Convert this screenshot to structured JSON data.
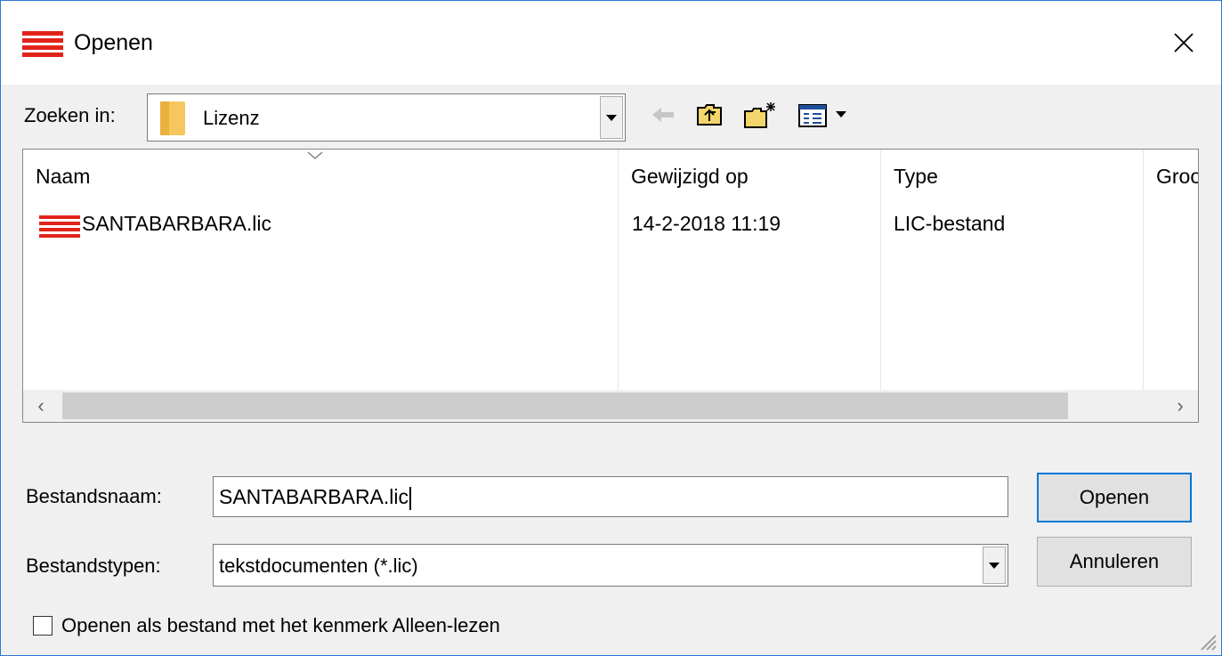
{
  "window": {
    "title": "Openen",
    "accent_color": "#e2231a"
  },
  "look_in": {
    "label": "Zoeken in:",
    "value": "Lizenz"
  },
  "toolbar": {
    "back_icon": "arrow-left-icon",
    "up_icon": "folder-up-icon",
    "new_folder_icon": "new-folder-icon",
    "view_icon": "view-menu-icon"
  },
  "file_list": {
    "columns": [
      "Naam",
      "Gewijzigd op",
      "Type",
      "Groo"
    ],
    "rows": [
      {
        "name": "SANTABARBARA.lic",
        "modified": "14-2-2018 11:19",
        "type": "LIC-bestand"
      }
    ]
  },
  "filename": {
    "label": "Bestandsnaam:",
    "value": "SANTABARBARA.lic"
  },
  "filetype": {
    "label": "Bestandstypen:",
    "value": "tekstdocumenten (*.lic)"
  },
  "buttons": {
    "open": "Openen",
    "cancel": "Annuleren"
  },
  "readonly": {
    "label": "Openen als bestand met het kenmerk Alleen-lezen",
    "checked": false
  }
}
